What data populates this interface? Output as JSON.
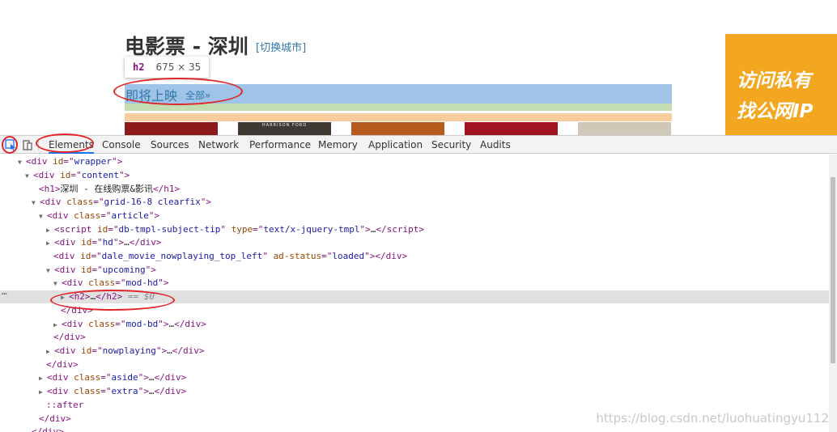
{
  "page": {
    "title": "电影票 - 深圳",
    "switch_city": "[切换城市]",
    "tooltip": {
      "tag": "h2",
      "size": "675 × 35"
    },
    "upcoming_title": "即将上映",
    "all_link": "全部»",
    "posters": [
      {
        "caption": "",
        "color": "#8c1a1a"
      },
      {
        "caption": "HARRISON FORD",
        "color": "#3e3a33"
      },
      {
        "caption": "",
        "color": "#b85c1e"
      },
      {
        "caption": "",
        "color": "#a01420"
      },
      {
        "caption": "",
        "color": "#cfc7b8"
      }
    ],
    "ad": {
      "line1": "访问私有",
      "line2": "找公网IP"
    }
  },
  "devtools": {
    "tabs": [
      "Elements",
      "Console",
      "Sources",
      "Network",
      "Performance",
      "Memory",
      "Application",
      "Security",
      "Audits"
    ],
    "active_tab": "Elements",
    "selected_suffix": "== $0",
    "more_dots": "…",
    "watermark": "https://blog.csdn.net/luohuatingyu112"
  },
  "colors": {
    "content_highlight": "#9fc4e7",
    "padding_highlight": "#c3dcb0",
    "margin_highlight": "#f7cd9e",
    "annotation_red": "#e0262a",
    "tag_purple": "#881280",
    "attr_name": "#994500",
    "attr_value": "#1a1aa6"
  }
}
